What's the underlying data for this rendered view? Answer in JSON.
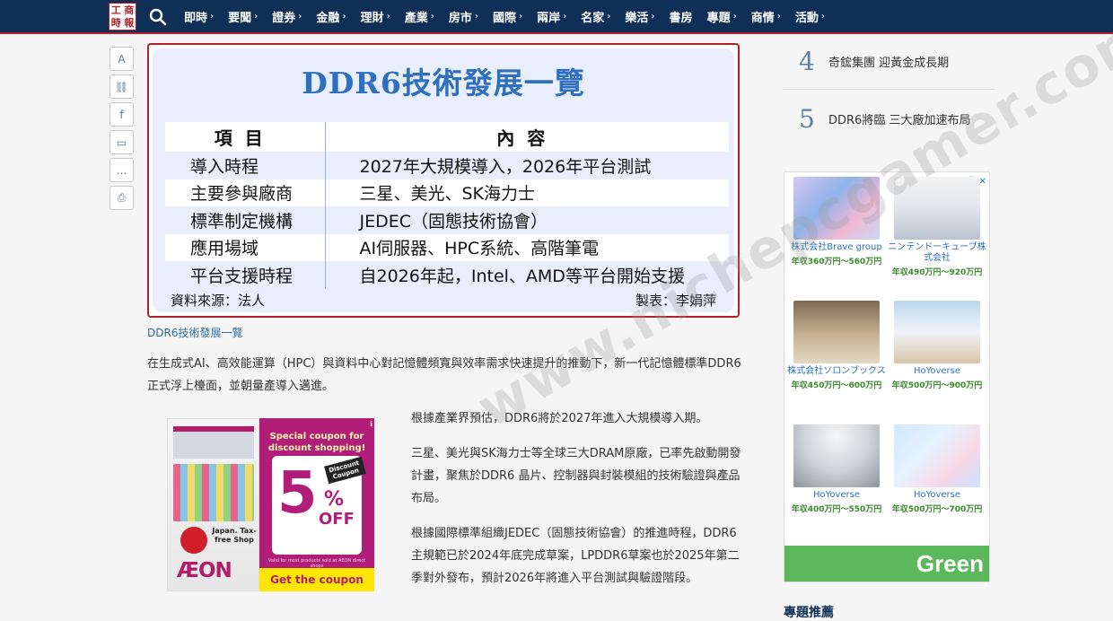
{
  "nav": {
    "logo_chars": [
      "工",
      "商",
      "時",
      "報"
    ],
    "items": [
      "即時",
      "要聞",
      "證券",
      "金融",
      "理財",
      "產業",
      "房市",
      "國際",
      "兩岸",
      "名家",
      "樂活",
      "書房",
      "專題",
      "商情",
      "活動"
    ]
  },
  "share": {
    "icons": [
      "font-size-icon",
      "link-icon",
      "facebook-icon",
      "line-icon",
      "comment-icon",
      "print-icon"
    ],
    "glyphs": [
      "A",
      "⛓",
      "f",
      "▭",
      "…",
      "⎙"
    ]
  },
  "feature": {
    "title": "DDR6技術發展一覽",
    "header": [
      "項目",
      "內容"
    ],
    "rows": [
      [
        "導入時程",
        "2027年大規模導入，2026年平台測試"
      ],
      [
        "主要參與廠商",
        "三星、美光、SK海力士"
      ],
      [
        "標準制定機構",
        "JEDEC（固態技術協會）"
      ],
      [
        "應用場域",
        "AI伺服器、HPC系統、高階筆電"
      ],
      [
        "平台支援時程",
        "自2026年起，Intel、AMD等平台開始支援"
      ]
    ],
    "source": "資料來源：法人",
    "maker": "製表：李娟萍"
  },
  "caption": "DDR6技術發展一覽",
  "article": {
    "para1": "在生成式AI、高效能運算（HPC）與資料中心對記憶體頻寬與效率需求快速提升的推動下，新一代記憶體標準DDR6正式浮上檯面，並朝量產導入邁進。",
    "para2": "根據產業界預估，DDR6將於2027年進入大規模導入期。",
    "para3": "三星、美光與SK海力士等全球三大DRAM原廠，已率先啟動開發計畫，聚焦於DDR6 晶片、控制器與封裝模組的技術驗證與產品布局。",
    "para4": "根據國際標準組織JEDEC（固態技術協會）的推進時程，DDR6主規範已於2024年底完成草案，LPDDR6草案也於2025年第二季對外發布，預計2026年將進入平台測試與驗證階段。"
  },
  "ad_left": {
    "brand": "ÆON",
    "special": "Special coupon for discount shopping!",
    "discount_tag": "Discount Coupon",
    "percent": "5",
    "percent_sign": "%",
    "off": "OFF",
    "japan": "Japan. Tax-free Shop",
    "fine_print": "Valid for most products sold at AEON direct shops",
    "cta": "Get the coupon",
    "info": "ℹ"
  },
  "ranking": [
    {
      "num": "4",
      "title": "奇鋐集團 迎黃金成長期"
    },
    {
      "num": "5",
      "title": "DDR6將臨 三大廠加速布局"
    }
  ],
  "ad_right": {
    "info": "ⓘ ✕",
    "cells": [
      {
        "name": "株式会社Brave group",
        "pay": "年収360万円～560万円"
      },
      {
        "name": "ニンテンドーキューブ株式会社",
        "pay": "年収490万円～920万円"
      },
      {
        "name": "株式会社ソロンブックス",
        "pay": "年収450万円～600万円"
      },
      {
        "name": "HoYoverse",
        "pay": "年収500万円～900万円"
      },
      {
        "name": "HoYoverse",
        "pay": "年収400万円～550万円"
      },
      {
        "name": "HoYoverse",
        "pay": "年収500万円～700万円"
      }
    ],
    "brand": "Green"
  },
  "topics_heading": "專題推薦",
  "watermark": "www.nichepcgamer.com"
}
